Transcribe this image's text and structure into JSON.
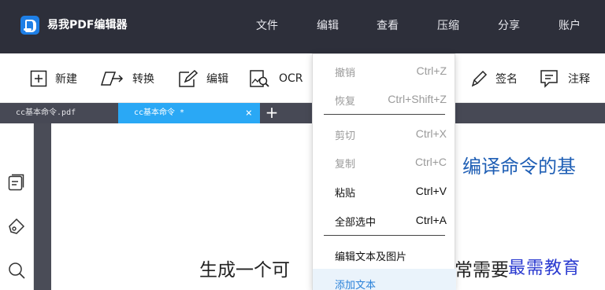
{
  "app": {
    "title": "易我PDF编辑器"
  },
  "menu": [
    "文件",
    "编辑",
    "查看",
    "压缩",
    "分享",
    "账户"
  ],
  "toolbar": {
    "new": "新建",
    "convert": "转换",
    "edit": "编辑",
    "ocr": "OCR",
    "sign": "签名",
    "annotate": "注释"
  },
  "tabs": [
    {
      "label": "cc基本命令.pdf"
    },
    {
      "label": "cc基本命令 *",
      "close": "×"
    }
  ],
  "tab_add": "+",
  "dropdown": {
    "items": [
      {
        "label": "撤销",
        "shortcut": "Ctrl+Z"
      },
      {
        "label": "恢复",
        "shortcut": "Ctrl+Shift+Z"
      },
      {
        "label": "剪切",
        "shortcut": "Ctrl+X"
      },
      {
        "label": "复制",
        "shortcut": "Ctrl+C"
      },
      {
        "label": "粘贴",
        "shortcut": "Ctrl+V"
      },
      {
        "label": "全部选中",
        "shortcut": "Ctrl+A"
      },
      {
        "label": "编辑文本及图片"
      },
      {
        "label": "添加文本"
      }
    ]
  },
  "document": {
    "heading": "编译命令的基",
    "line_left": "生成一个可",
    "line_right": "常需要"
  },
  "watermark": "最需教育",
  "colors": {
    "titlebar": "#2d2f3a",
    "tab_active": "#2aa8f5",
    "heading": "#1f5fb5",
    "watermark": "#2a3ad0"
  }
}
